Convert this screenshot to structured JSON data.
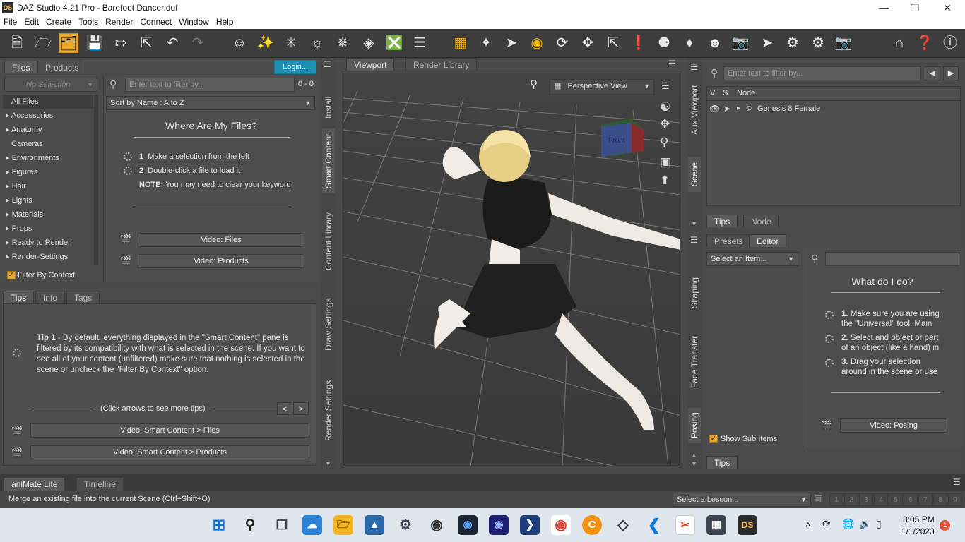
{
  "window": {
    "title": "DAZ Studio 4.21 Pro - Barefoot Dancer.duf",
    "logo": "DS"
  },
  "menu": [
    "File",
    "Edit",
    "Create",
    "Tools",
    "Render",
    "Connect",
    "Window",
    "Help"
  ],
  "left_panel": {
    "tabs": [
      "Files",
      "Products"
    ],
    "login": "Login...",
    "selection_dropdown": "No Selection",
    "filter_placeholder": "Enter text to filter by...",
    "count": "0 - 0",
    "sort": "Sort by Name : A to Z",
    "tree": [
      "All Files",
      "Accessories",
      "Anatomy",
      "Cameras",
      "Environments",
      "Figures",
      "Hair",
      "Lights",
      "Materials",
      "Props",
      "Ready to Render",
      "Render-Settings"
    ],
    "filter_by_context": "Filter By Context",
    "where_title": "Where Are My Files?",
    "step1": "Make a selection from the left",
    "step2": "Double-click a file to load it",
    "note_label": "NOTE:",
    "note_text": "You may need to clear your keyword",
    "video_files": "Video: Files",
    "video_products": "Video:  Products"
  },
  "tips_panel": {
    "tabs": [
      "Tips",
      "Info",
      "Tags"
    ],
    "tip_label": "Tip 1",
    "tip_text": " - By default, everything displayed in the \"Smart Content\" pane is filtered by its compatibility with what is selected in the scene. If you want to see all of your content (unfiltered) make sure that nothing is selected in the scene or uncheck the \"Filter By Context\" option.",
    "nav_hint": "(Click arrows to see more tips)",
    "prev": "<",
    "next": ">",
    "video1": "Video: Smart Content > Files",
    "video2": "Video: Smart Content > Products"
  },
  "left_vtabs": [
    "Install",
    "Smart Content",
    "Content Library",
    "Draw Settings",
    "Render Settings"
  ],
  "viewport": {
    "tabs": [
      "Viewport",
      "Render Library"
    ],
    "view": "Perspective View",
    "cube_label": "Front"
  },
  "right_vtabs_top": [
    "Aux Viewport",
    "Scene"
  ],
  "right_vtabs_bottom": [
    "Shaping",
    "Face Transfer",
    "Posing"
  ],
  "scene_panel": {
    "filter_placeholder": "Enter text to filter by...",
    "cols": [
      "V",
      "S",
      "Node"
    ],
    "node": "Genesis 8 Female",
    "tabs": [
      "Tips",
      "Node"
    ]
  },
  "posing_panel": {
    "tabs": [
      "Presets",
      "Editor"
    ],
    "select": "Select an Item...",
    "title": "What do I do?",
    "step1_a": "Make sure you are using",
    "step1_b": "the \"Universal\" tool. Main",
    "step2_a": "Select and object or part",
    "step2_b": "of an object (like a hand) in",
    "step3_a": "Drag your selection",
    "step3_b": "around in the scene or use",
    "show_sub": "Show Sub Items",
    "video": "Video: Posing",
    "tips_tab": "Tips"
  },
  "bottom": {
    "tabs": [
      "aniMate Lite",
      "Timeline"
    ],
    "status": "Merge an existing file into the current Scene (Ctrl+Shift+O)",
    "lesson": "Select a Lesson...",
    "pages": [
      "1",
      "2",
      "3",
      "4",
      "5",
      "6",
      "7",
      "8",
      "9"
    ]
  },
  "taskbar": {
    "time": "8:05 PM",
    "date": "1/1/2023",
    "badge": "1",
    "ds_label": "DS"
  }
}
